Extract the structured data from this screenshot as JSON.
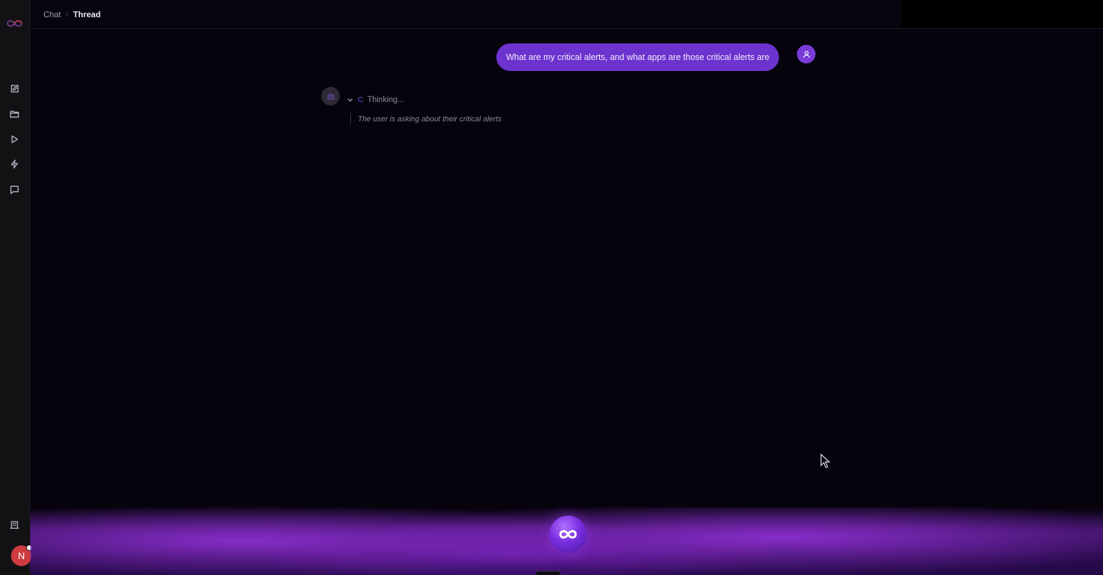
{
  "header": {
    "breadcrumb": [
      {
        "label": "Chat"
      },
      {
        "label": "Thread"
      }
    ],
    "separator": "›"
  },
  "sidebar": {
    "logo": "infinity-logo-icon",
    "items": [
      {
        "icon": "new-chat-icon"
      },
      {
        "icon": "folder-icon"
      },
      {
        "icon": "play-icon"
      },
      {
        "icon": "lightning-icon"
      },
      {
        "icon": "message-icon"
      }
    ],
    "bottom_icon": "building-icon",
    "user_initial": "N"
  },
  "chat": {
    "user_message": "What are my critical alerts, and what apps are those critical alerts are",
    "thinking": {
      "spinner": "C",
      "label": "Thinking...",
      "thought": "The user is asking about their critical alerts"
    }
  },
  "colors": {
    "accent": "#6d33cf",
    "avatar": "#cf3b41",
    "background": "#06030d",
    "sidebar": "#121215"
  }
}
